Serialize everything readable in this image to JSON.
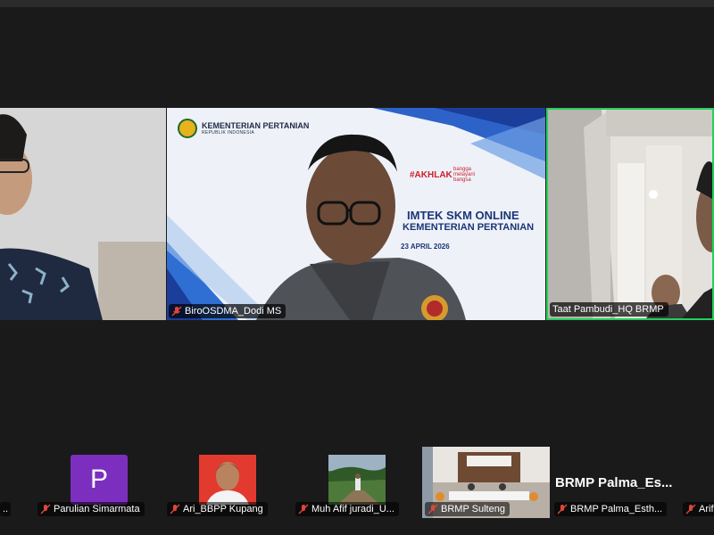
{
  "main_tiles": {
    "center": {
      "name": "BiroOSDMA_Dodi MS",
      "slide": {
        "org_name": "KEMENTERIAN PERTANIAN",
        "org_sub": "REPUBLIK INDONESIA",
        "akhlak": "#AKHLAK",
        "bangga": "bangga melayani bangsa",
        "title_line1": "IMTEK SKM ONLINE",
        "title_line2": "KEMENTERIAN PERTANIAN",
        "date": "23 APRIL 2026"
      }
    },
    "right": {
      "name": "Taat Pambudi_HQ BRMP"
    }
  },
  "bottom_strip": {
    "partial_left_tag": "..",
    "participants": [
      {
        "name": "Parulian Simarmata",
        "avatar_letter": "P"
      },
      {
        "name": "Ari_BBPP Kupang"
      },
      {
        "name": "Muh Afif juradi_U..."
      },
      {
        "name": "BRMP Sulteng"
      },
      {
        "name": "BRMP Palma_Esth...",
        "display_name": "BRMP  Palma_Es..."
      },
      {
        "name": "Arif"
      }
    ]
  },
  "colors": {
    "active_speaker_border": "#23d05b",
    "avatar_purple": "#7c2fbf",
    "mic_muted_red": "#e0453a"
  }
}
